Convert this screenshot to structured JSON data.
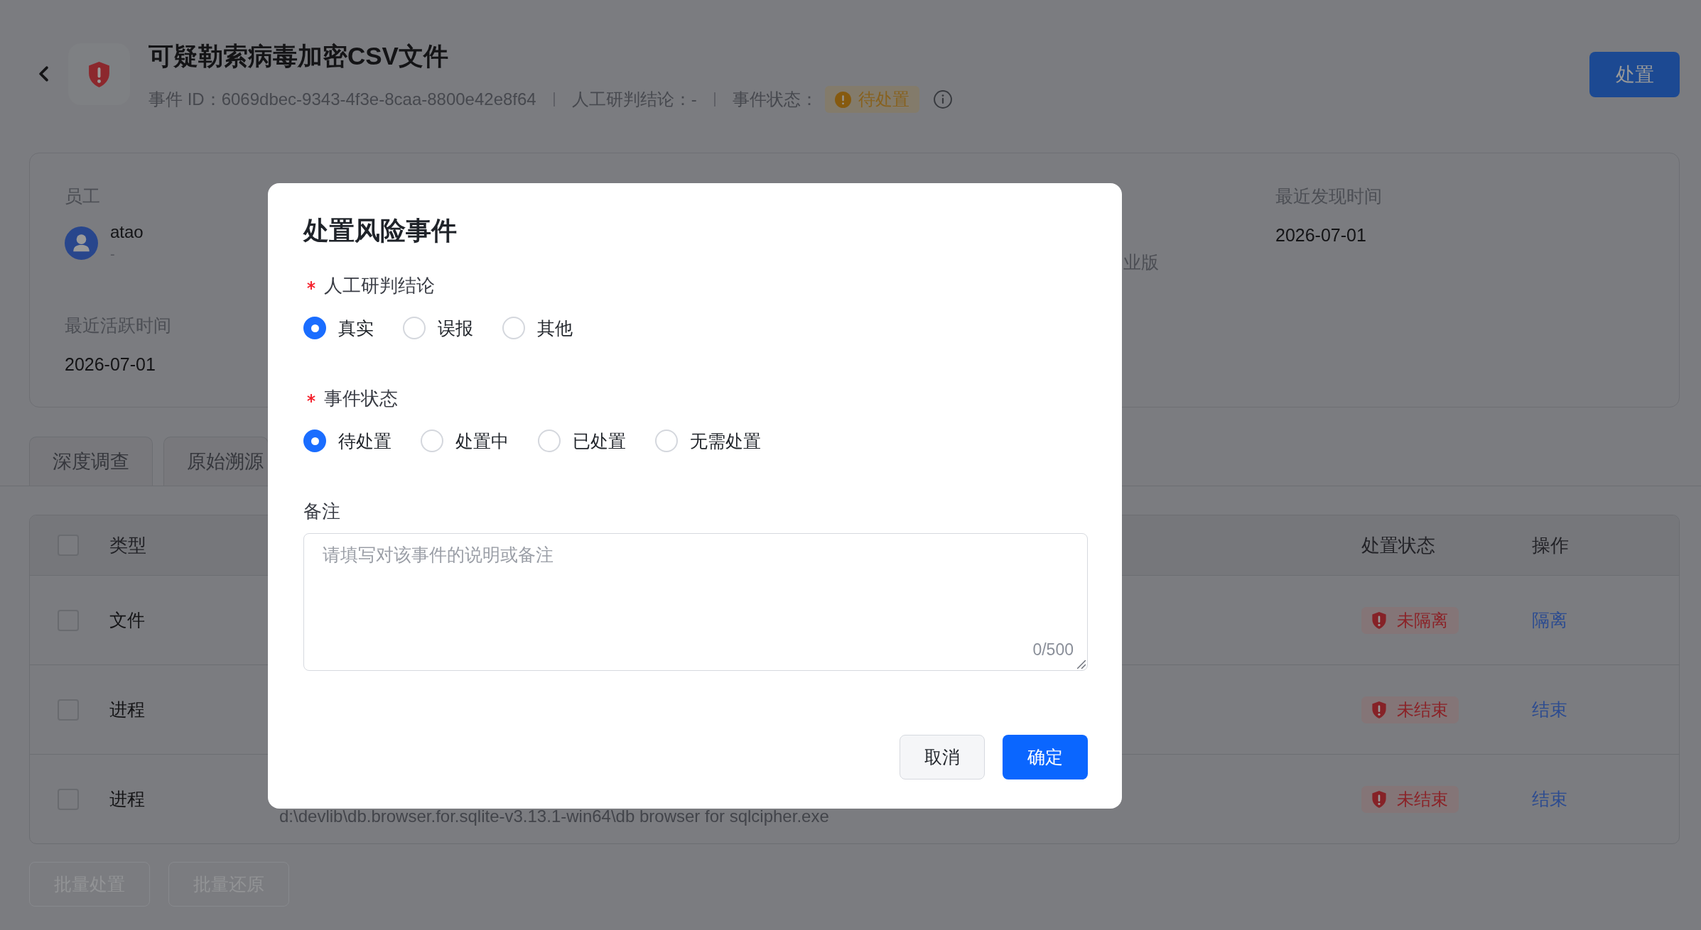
{
  "header": {
    "title": "可疑勒索病毒加密CSV文件",
    "event_id": "事件 ID：6069dbec-9343-4f3e-8caa-8800e42e8f64",
    "conclusion": "人工研判结论：-",
    "status_label": "事件状态：",
    "status_tag": "待处置",
    "action_button": "处置"
  },
  "info_card": {
    "employee": {
      "label": "员工",
      "name": "atao",
      "detail": "-"
    },
    "column_3": {
      "value": "业版"
    },
    "last_found": {
      "label": "最近发现时间",
      "value": "2026-07-01"
    },
    "last_active": {
      "label": "最近活跃时间",
      "value": "2026-07-01"
    }
  },
  "tabs": [
    {
      "label": "深度调查"
    },
    {
      "label": "原始溯源"
    }
  ],
  "table": {
    "select_all": {
      "checked": false
    },
    "columns": [
      {
        "label": "类型"
      },
      {
        "label": "处置状态"
      },
      {
        "label": "操作"
      }
    ],
    "rows": [
      {
        "checked": false,
        "type": "文件",
        "status": "未隔离",
        "action": "隔离"
      },
      {
        "checked": false,
        "type": "进程",
        "status": "未结束",
        "action": "结束"
      },
      {
        "checked": false,
        "type": "进程",
        "column_3": "d:\\devlib\\db.browser.for.sqlite-v3.13.1-win64\\db browser for sqlcipher.exe",
        "status": "未结束",
        "action": "结束"
      }
    ]
  },
  "bulk_buttons": [
    {
      "label": "批量处置",
      "disabled": true
    },
    {
      "label": "批量还原",
      "disabled": true
    }
  ],
  "dialog": {
    "title": "处置风险事件",
    "fields": [
      {
        "kind": "radio",
        "label": "人工研判结论",
        "required": true,
        "options": [
          {
            "label": "真实",
            "selected": true
          },
          {
            "label": "误报",
            "selected": false
          },
          {
            "label": "其他",
            "selected": false
          }
        ]
      },
      {
        "kind": "radio",
        "label": "事件状态",
        "required": true,
        "options": [
          {
            "label": "待处置",
            "selected": true
          },
          {
            "label": "处置中",
            "selected": false
          },
          {
            "label": "已处置",
            "selected": false
          },
          {
            "label": "无需处置",
            "selected": false
          }
        ]
      },
      {
        "kind": "textarea",
        "label": "备注",
        "required": false,
        "placeholder": "请填写对该事件的说明或备注",
        "counter": "0/500"
      }
    ],
    "buttons": [
      {
        "label": "取消",
        "kind": "secondary"
      },
      {
        "label": "确定",
        "kind": "primary"
      }
    ]
  }
}
